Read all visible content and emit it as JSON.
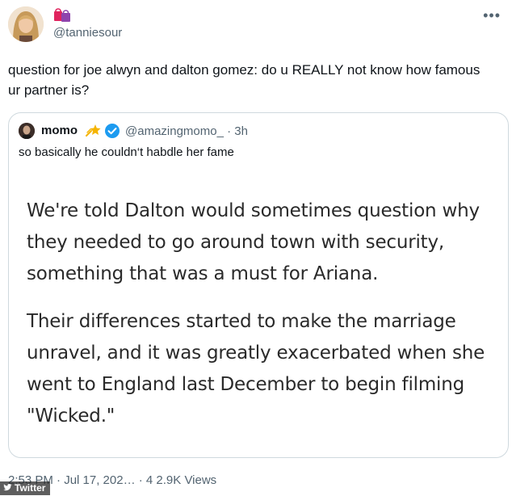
{
  "author": {
    "handle": "@tanniesour",
    "avatar_icon": "profile-photo",
    "badge_icon": "shopping-bags-emoji"
  },
  "more_icon": "more-horizontal-icon",
  "tweet": {
    "text": "question for joe alwyn and dalton gomez: do u REALLY not know how famous ur partner is?"
  },
  "quoted": {
    "name": "momo",
    "name_emoji_icon": "shooting-star-emoji",
    "verified_icon": "verified-badge-icon",
    "handle": "@amazingmomo_",
    "separator": "·",
    "time": "3h",
    "text": "so basically he couldn‘t habdle her fame",
    "article": {
      "paragraph_1": "We're told Dalton would sometimes question why they needed to go around town with security, something that was a must for Ariana.",
      "paragraph_2": "Their differences started to make the marriage unravel, and it was greatly exacerbated when she went to England last December to begin filming \"Wicked.\""
    }
  },
  "footer": {
    "meta": "2:53 PM · Jul 17, 202… · 4 2.9K Views"
  },
  "watermark": {
    "label": "Twitter",
    "icon": "twitter-bird-icon"
  },
  "colors": {
    "text": "#0f1419",
    "secondary": "#536471",
    "border": "#cfd9de",
    "verified": "#1d9bf0"
  }
}
